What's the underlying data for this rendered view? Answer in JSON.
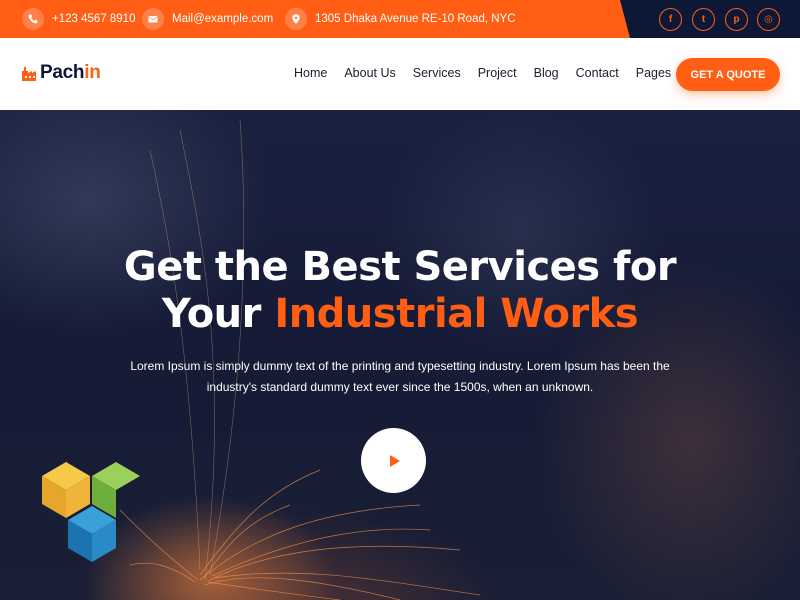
{
  "topbar": {
    "phone": "+123 4567 8910",
    "email": "Mail@example.com",
    "address": "1305 Dhaka Avenue RE-10 Road, NYC",
    "socials": [
      {
        "name": "facebook",
        "glyph": "f"
      },
      {
        "name": "twitter",
        "glyph": "t"
      },
      {
        "name": "pinterest",
        "glyph": "p"
      },
      {
        "name": "instagram",
        "glyph": "◎"
      }
    ]
  },
  "brand": {
    "logo_main": "Pach",
    "logo_accent": "in"
  },
  "nav": {
    "items": [
      "Home",
      "About Us",
      "Services",
      "Project",
      "Blog",
      "Contact",
      "Pages"
    ],
    "cta": "GET A QUOTE"
  },
  "hero": {
    "title_line1": "Get the Best Services for",
    "title_line2_plain": "Your ",
    "title_line2_accent": "Industrial Works",
    "description": "Lorem Ipsum is simply dummy text of the printing and typesetting industry. Lorem Ipsum has been the industry's standard dummy text ever since the 1500s, when an unknown."
  },
  "colors": {
    "accent": "#ff5e14",
    "dark": "#0d1836",
    "white": "#ffffff"
  },
  "icons": {
    "phone": "phone-icon",
    "email": "email-icon",
    "location": "location-icon",
    "play": "play-icon",
    "logo": "factory-icon",
    "badge": "visual-composer-logo"
  }
}
